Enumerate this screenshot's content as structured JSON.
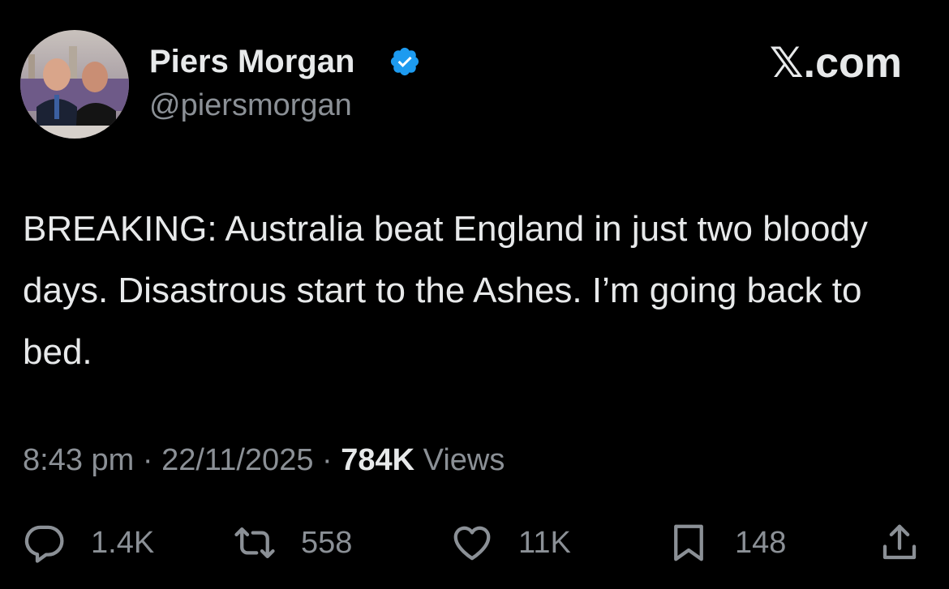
{
  "author": {
    "display_name": "Piers Morgan",
    "handle": "@piersmorgan",
    "verified": true
  },
  "site_mark": "𝕏.com",
  "tweet": {
    "text": "BREAKING: Australia beat England in just two bloody days. Disastrous start to the Ashes. I’m going back to bed."
  },
  "meta": {
    "time": "8:43 pm",
    "separator": "·",
    "date": "22/11/2025",
    "views_count": "784K",
    "views_label": "Views"
  },
  "actions": {
    "replies": "1.4K",
    "reposts": "558",
    "likes": "11K",
    "bookmarks": "148"
  },
  "colors": {
    "background": "#000000",
    "primary_text": "#e7e9ea",
    "secondary_text": "#8b9096",
    "verified_blue": "#1d9bf0"
  },
  "icons": {
    "verified": "verified-badge-icon",
    "reply": "reply-icon",
    "repost": "repost-icon",
    "like": "heart-icon",
    "bookmark": "bookmark-icon",
    "share": "share-icon"
  }
}
